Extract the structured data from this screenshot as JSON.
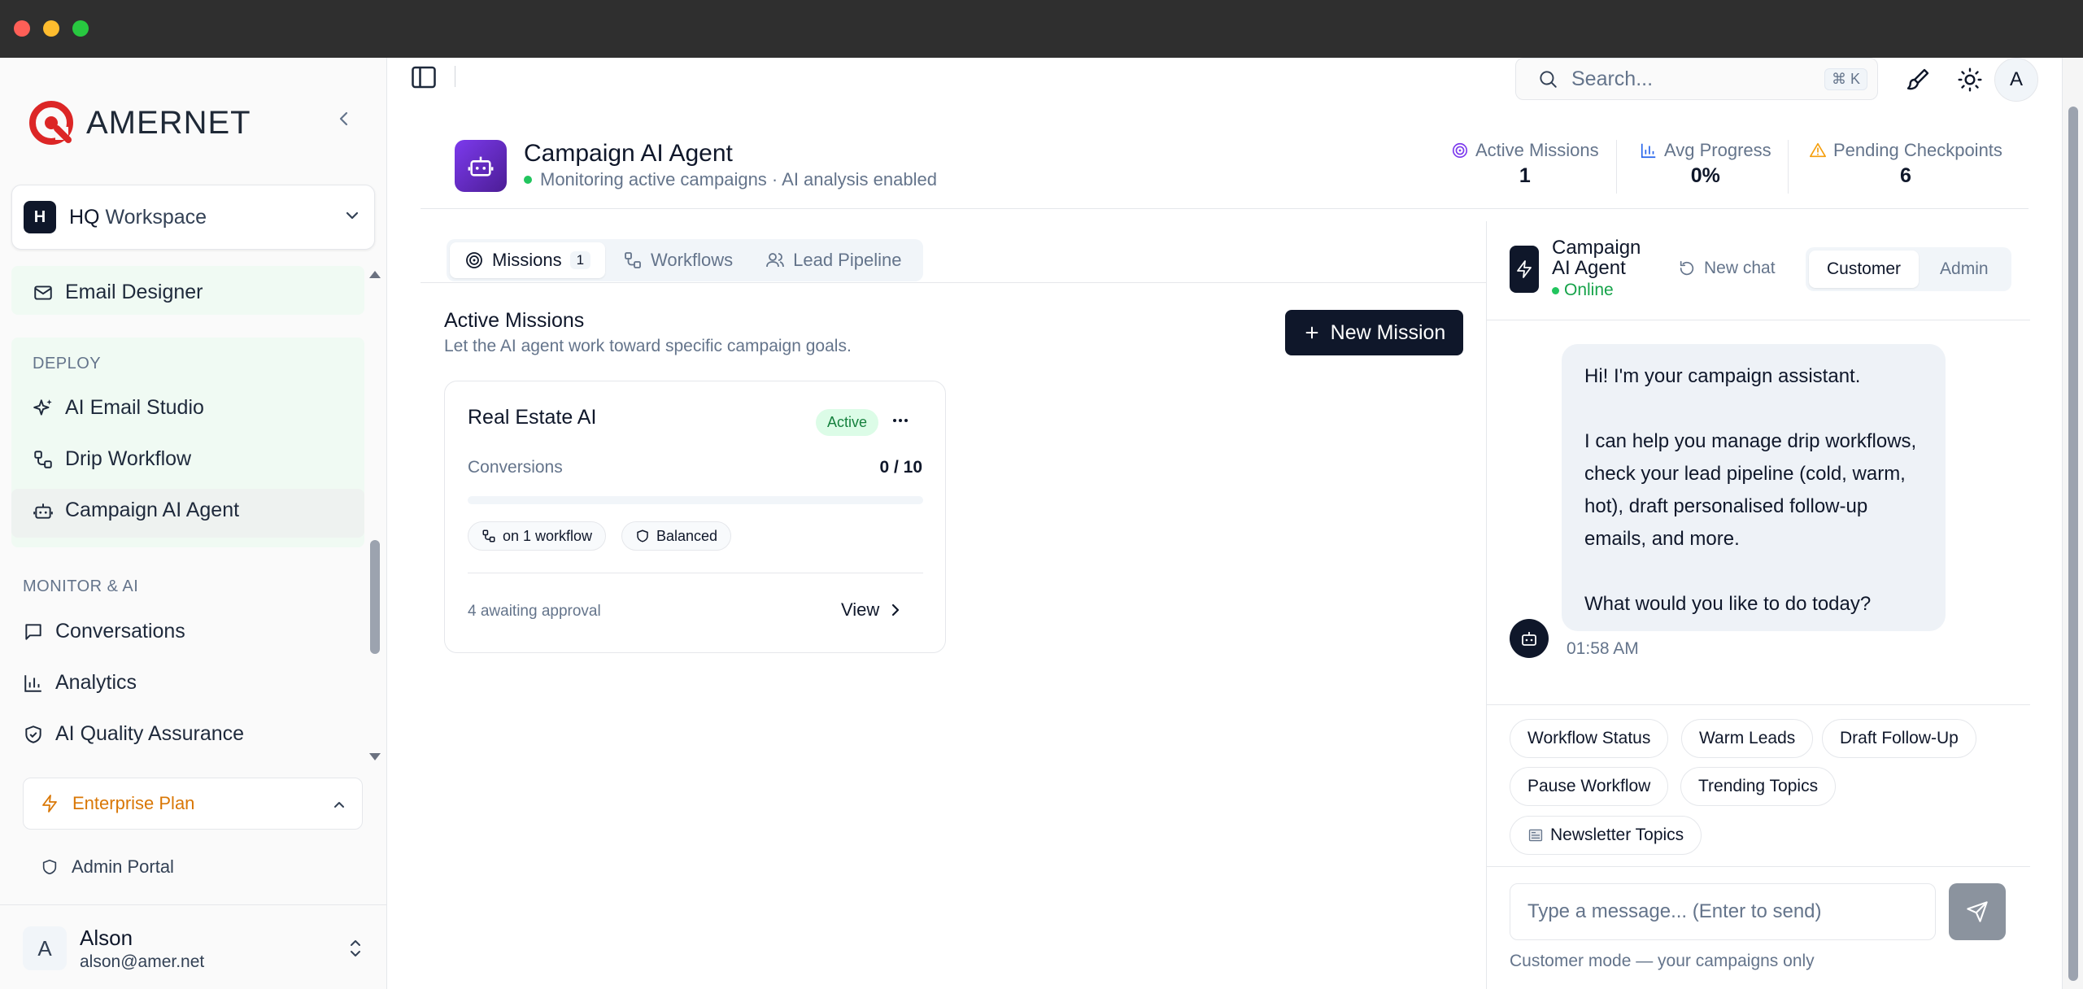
{
  "sidebar": {
    "brand": "AMERNET",
    "workspace": {
      "badge": "H",
      "name_1": "HQ",
      "name_2": "Workspace"
    },
    "items": {
      "email_designer": "Email Designer",
      "deploy_label": "DEPLOY",
      "ai_email_studio": "AI Email Studio",
      "drip_workflow": "Drip Workflow",
      "campaign_ai_agent": "Campaign AI Agent",
      "monitor_label": "MONITOR & AI",
      "conversations": "Conversations",
      "analytics": "Analytics",
      "ai_quality": "AI Quality Assurance"
    },
    "plan": "Enterprise Plan",
    "admin_portal": "Admin Portal",
    "user": {
      "initial": "A",
      "name": "Alson",
      "email": "alson@amer.net"
    }
  },
  "topbar": {
    "search_placeholder": "Search...",
    "search_shortcut": "⌘ K",
    "avatar_initial": "A"
  },
  "header": {
    "title": "Campaign AI Agent",
    "subtitle": "Monitoring active campaigns · AI analysis enabled",
    "stats": [
      {
        "label": "Active Missions",
        "value": "1"
      },
      {
        "label": "Avg Progress",
        "value": "0%"
      },
      {
        "label": "Pending Checkpoints",
        "value": "6"
      }
    ]
  },
  "tabs": {
    "missions": "Missions",
    "missions_count": "1",
    "workflows": "Workflows",
    "lead_pipeline": "Lead Pipeline"
  },
  "missions": {
    "title": "Active Missions",
    "subtitle": "Let the AI agent work toward specific campaign goals.",
    "new_button": "New Mission",
    "card": {
      "title": "Real Estate AI",
      "status": "Active",
      "conversions_label": "Conversions",
      "conversions_value": "0 / 10",
      "progress": 0,
      "chip_workflow": "on 1 workflow",
      "chip_mode": "Balanced",
      "awaiting": "4 awaiting approval",
      "view": "View"
    }
  },
  "chat": {
    "agent_name": "Campaign AI Agent",
    "status": "Online",
    "new_chat": "New chat",
    "modes": [
      "Customer",
      "Admin"
    ],
    "message": "Hi! I'm your campaign assistant.\n\nI can help you manage drip workflows, check your lead pipeline (cold, warm, hot), draft personalised follow-up emails, and more.\n\nWhat would you like to do today?",
    "time": "01:58 AM",
    "quick_actions": [
      "Workflow Status",
      "Warm Leads",
      "Draft Follow-Up",
      "Pause Workflow",
      "Trending Topics",
      "Newsletter Topics"
    ],
    "input_placeholder": "Type a message...  (Enter to send)",
    "footer": "Customer mode — your campaigns only"
  },
  "colors": {
    "accent_dark": "#0f172a",
    "agent_purple": "#7c3aed",
    "online_green": "#22c55e",
    "warning_amber": "#d97706",
    "brand_red": "#dc2626"
  }
}
